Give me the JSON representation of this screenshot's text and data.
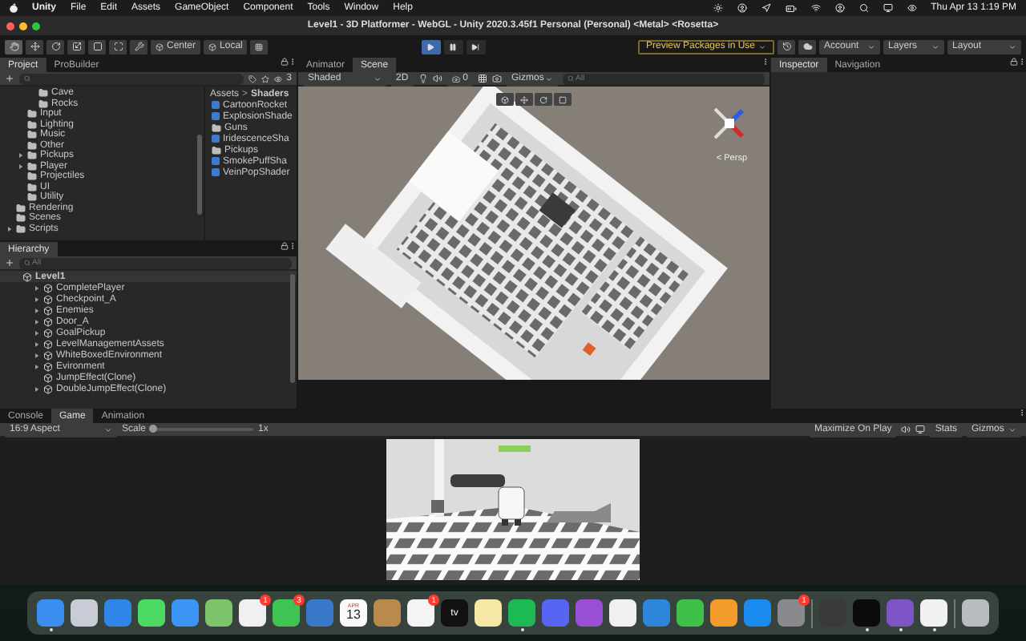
{
  "menu_bar": {
    "app": "Unity",
    "items": [
      "File",
      "Edit",
      "Assets",
      "GameObject",
      "Component",
      "Tools",
      "Window",
      "Help"
    ],
    "clock": "Thu Apr 13  1:19 PM"
  },
  "window": {
    "title": "Level1 - 3D Platformer - WebGL - Unity 2020.3.45f1 Personal (Personal) <Metal> <Rosetta>"
  },
  "toolbar": {
    "tools": [
      {
        "kind": "hand",
        "selected": true
      },
      {
        "kind": "move",
        "selected": false
      },
      {
        "kind": "rotate",
        "selected": false
      },
      {
        "kind": "scale",
        "selected": false
      },
      {
        "kind": "rect",
        "selected": false
      },
      {
        "kind": "transform",
        "selected": false
      },
      {
        "kind": "custom",
        "selected": false
      }
    ],
    "pivot": "Center",
    "space": "Local",
    "playback": [
      {
        "kind": "play",
        "selected": true
      },
      {
        "kind": "pause",
        "selected": false
      },
      {
        "kind": "step",
        "selected": false
      }
    ],
    "packages": "Preview Packages in Use",
    "account": "Account",
    "layers": "Layers",
    "layout": "Layout"
  },
  "project": {
    "tabs": [
      {
        "label": "Project",
        "selected": true
      },
      {
        "label": "ProBuilder",
        "selected": false
      }
    ],
    "hidden_count": "3",
    "tree": [
      {
        "children": [
          {
            "children": [
              {
                "label": "Cave",
                "arrow": false
              },
              {
                "label": "Rocks",
                "arrow": false
              }
            ]
          },
          {
            "label": "Input",
            "arrow": false
          },
          {
            "label": "Lighting",
            "arrow": false
          },
          {
            "label": "Music",
            "arrow": false
          },
          {
            "label": "Other",
            "arrow": false
          },
          {
            "label": "Pickups",
            "arrow": true
          },
          {
            "label": "Player",
            "arrow": true
          },
          {
            "label": "Projectiles",
            "arrow": false
          },
          {
            "label": "UI",
            "arrow": false
          },
          {
            "label": "Utility",
            "arrow": false
          }
        ]
      },
      {
        "label": "Rendering",
        "arrow": false
      },
      {
        "label": "Scenes",
        "arrow": false
      },
      {
        "label": "Scripts",
        "arrow": true
      }
    ],
    "breadcrumb": [
      "Assets",
      "Shaders"
    ],
    "breadcrumb_separator": ">",
    "assets": [
      {
        "kind": "shader",
        "label": "CartoonRocket"
      },
      {
        "kind": "shader",
        "label": "ExplosionShade"
      },
      {
        "kind": "folder",
        "label": "Guns"
      },
      {
        "kind": "shader",
        "label": "IridescenceSha"
      },
      {
        "kind": "folder",
        "label": "Pickups"
      },
      {
        "kind": "shader",
        "label": "SmokePuffSha"
      },
      {
        "kind": "shader",
        "label": "VeinPopShader"
      }
    ]
  },
  "hierarchy": {
    "tab": "Hierarchy",
    "search": {
      "placeholder": "All"
    },
    "root": {
      "label": "Level1",
      "children": [
        {
          "label": "CompletePlayer",
          "arrow": true
        },
        {
          "label": "Checkpoint_A",
          "arrow": true
        },
        {
          "label": "Enemies",
          "arrow": true
        },
        {
          "label": "Door_A",
          "arrow": true
        },
        {
          "label": "GoalPickup",
          "arrow": true
        },
        {
          "label": "LevelManagementAssets",
          "arrow": true
        },
        {
          "label": "WhiteBoxedEnvironment",
          "arrow": true
        },
        {
          "label": "Evironment",
          "arrow": true
        },
        {
          "label": "JumpEffect(Clone)",
          "arrow": false
        },
        {
          "label": "DoubleJumpEffect(Clone)",
          "arrow": true
        }
      ]
    }
  },
  "scene": {
    "tabs": [
      {
        "label": "Animator",
        "selected": false
      },
      {
        "label": "Scene",
        "selected": true
      }
    ],
    "shading": "Shaded",
    "mode_2d": "2D",
    "effects_count": "0",
    "gizmos": "Gizmos",
    "search": {
      "placeholder": "All"
    },
    "projection": "< Persp"
  },
  "inspector": {
    "tabs": [
      {
        "label": "Inspector",
        "selected": true
      },
      {
        "label": "Navigation",
        "selected": false
      }
    ]
  },
  "game": {
    "tabs": [
      {
        "label": "Console",
        "selected": false
      },
      {
        "label": "Game",
        "selected": true
      },
      {
        "label": "Animation",
        "selected": false
      }
    ],
    "aspect": "16:9 Aspect",
    "scale_label": "Scale",
    "scale": {
      "level": 0.02
    },
    "scale_value": "1x",
    "maximize": "Maximize On Play",
    "stats": "Stats",
    "gizmos": "Gizmos"
  },
  "dock": {
    "apps": [
      {
        "color": "#3a8ef0",
        "running": true
      },
      {
        "color": "#c9ccd6",
        "running": false
      },
      {
        "color": "#2f86e8",
        "running": false
      },
      {
        "color": "#4cd964",
        "running": false
      },
      {
        "color": "#3b95f5",
        "running": false
      },
      {
        "color": "#7cc56a",
        "running": false
      },
      {
        "color": "#f0f0f0",
        "running": false,
        "badge": "1"
      },
      {
        "color": "#3fc353",
        "running": false,
        "badge": "3"
      },
      {
        "color": "#3a79c9",
        "running": false
      },
      {
        "color": "#fafafa",
        "running": false,
        "top": "APR",
        "label": "13"
      },
      {
        "color": "#b88a4c",
        "running": false
      },
      {
        "color": "#f4f4f4",
        "running": false,
        "badge": "1"
      },
      {
        "color": "#111111",
        "running": false,
        "label": "tv"
      },
      {
        "color": "#f5e7a6",
        "running": false
      },
      {
        "color": "#1db954",
        "running": true
      },
      {
        "color": "#5865f2",
        "running": false
      },
      {
        "color": "#9b4fd4",
        "running": false
      },
      {
        "color": "#f0f0f0",
        "running": false
      },
      {
        "color": "#2d86d9",
        "running": false
      },
      {
        "color": "#3fc04a",
        "running": false
      },
      {
        "color": "#f39b2b",
        "running": false
      },
      {
        "color": "#1a8cf0",
        "running": false
      },
      {
        "color": "#8a8a8e",
        "running": false,
        "badge": "1"
      },
      {
        "color": "#3a3a3a",
        "running": false,
        "divider": true
      },
      {
        "color": "#0b0b0b",
        "running": true
      },
      {
        "color": "#7d55c7",
        "running": true
      },
      {
        "color": "#f1f1f1",
        "running": true
      },
      {
        "color": "#b8bcc0",
        "running": false,
        "divider": true
      }
    ]
  }
}
